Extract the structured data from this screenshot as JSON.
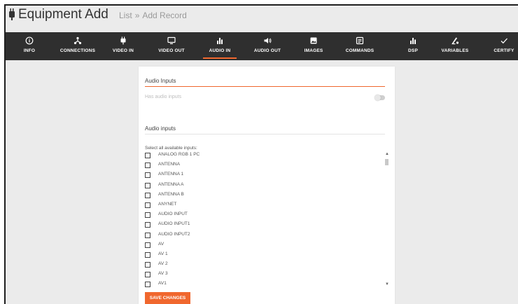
{
  "header": {
    "title": "Equipment Add",
    "breadcrumb_list": "List",
    "breadcrumb_sep": "»",
    "breadcrumb_current": "Add Record"
  },
  "tabs": [
    {
      "label": "INFO",
      "icon": "info-icon"
    },
    {
      "label": "CONNECTIONS",
      "icon": "connections-icon"
    },
    {
      "label": "VIDEO IN",
      "icon": "plug-icon"
    },
    {
      "label": "VIDEO OUT",
      "icon": "monitor-icon"
    },
    {
      "label": "AUDIO IN",
      "icon": "audio-bars-icon",
      "active": true
    },
    {
      "label": "AUDIO OUT",
      "icon": "speaker-icon"
    },
    {
      "label": "IMAGES",
      "icon": "image-icon"
    },
    {
      "label": "COMMANDS",
      "icon": "commands-icon"
    },
    {
      "label": "DSP",
      "icon": "dsp-bars-icon"
    },
    {
      "label": "VARIABLES",
      "icon": "variables-icon"
    },
    {
      "label": "CERTIFY",
      "icon": "check-icon"
    }
  ],
  "form": {
    "section_title": "Audio Inputs",
    "has_inputs_label": "Has audio inputs",
    "has_inputs_enabled": false,
    "inputs_title": "Audio inputs",
    "select_label": "Select all available inputs:",
    "inputs": [
      "ANALOG RGB 1 PC",
      "ANTENNA",
      "ANTENNA 1",
      "ANTENNA A",
      "ANTENNA B",
      "ANYNET",
      "AUDIO INPUT",
      "AUDIO INPUT1",
      "AUDIO INPUT2",
      "AV",
      "AV 1",
      "AV 2",
      "AV 3",
      "AV1"
    ],
    "save_label": "SAVE CHANGES"
  },
  "colors": {
    "accent": "#f0672e",
    "tabbar": "#2f2f2f",
    "page_bg": "#ebebeb"
  }
}
